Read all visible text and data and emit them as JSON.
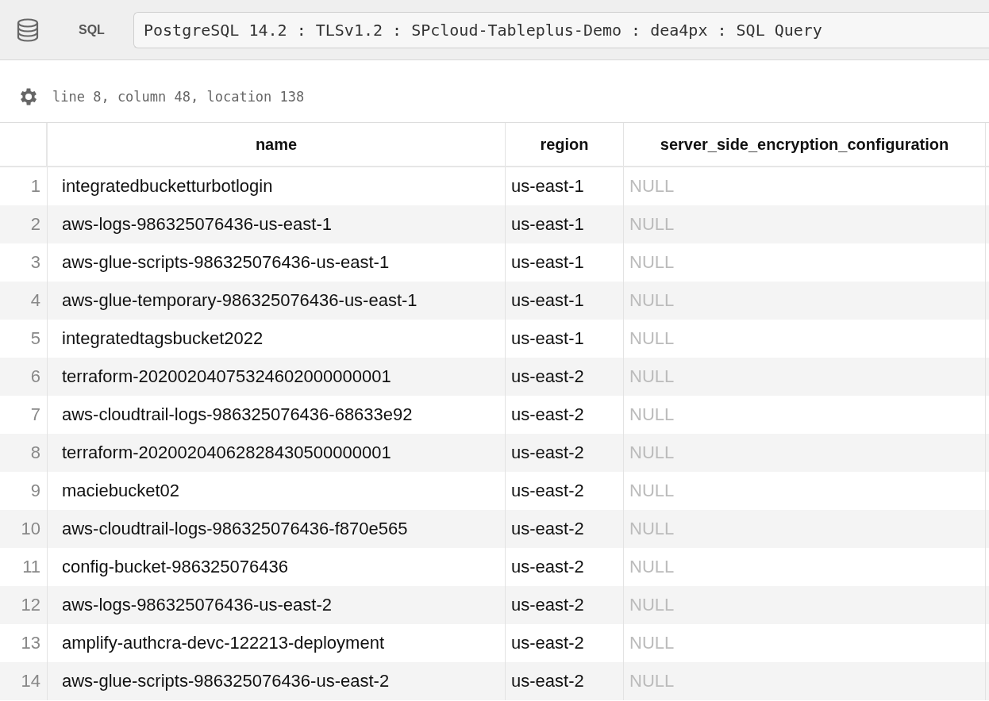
{
  "toolbar": {
    "label": "SQL",
    "connection": "PostgreSQL 14.2 : TLSv1.2 : SPcloud-Tableplus-Demo : dea4px : SQL Query"
  },
  "status": "line 8, column 48, location 138",
  "table": {
    "columns": [
      "name",
      "region",
      "server_side_encryption_configuration"
    ],
    "rows": [
      {
        "num": "1",
        "name": "integratedbucketturbotlogin",
        "region": "us-east-1",
        "config": "NULL"
      },
      {
        "num": "2",
        "name": "aws-logs-986325076436-us-east-1",
        "region": "us-east-1",
        "config": "NULL"
      },
      {
        "num": "3",
        "name": "aws-glue-scripts-986325076436-us-east-1",
        "region": "us-east-1",
        "config": "NULL"
      },
      {
        "num": "4",
        "name": "aws-glue-temporary-986325076436-us-east-1",
        "region": "us-east-1",
        "config": "NULL"
      },
      {
        "num": "5",
        "name": "integratedtagsbucket2022",
        "region": "us-east-1",
        "config": "NULL"
      },
      {
        "num": "6",
        "name": "terraform-20200204075324602000000001",
        "region": "us-east-2",
        "config": "NULL"
      },
      {
        "num": "7",
        "name": "aws-cloudtrail-logs-986325076436-68633e92",
        "region": "us-east-2",
        "config": "NULL"
      },
      {
        "num": "8",
        "name": "terraform-20200204062828430500000001",
        "region": "us-east-2",
        "config": "NULL"
      },
      {
        "num": "9",
        "name": "maciebucket02",
        "region": "us-east-2",
        "config": "NULL"
      },
      {
        "num": "10",
        "name": "aws-cloudtrail-logs-986325076436-f870e565",
        "region": "us-east-2",
        "config": "NULL"
      },
      {
        "num": "11",
        "name": "config-bucket-986325076436",
        "region": "us-east-2",
        "config": "NULL"
      },
      {
        "num": "12",
        "name": "aws-logs-986325076436-us-east-2",
        "region": "us-east-2",
        "config": "NULL"
      },
      {
        "num": "13",
        "name": "amplify-authcra-devc-122213-deployment",
        "region": "us-east-2",
        "config": "NULL"
      },
      {
        "num": "14",
        "name": "aws-glue-scripts-986325076436-us-east-2",
        "region": "us-east-2",
        "config": "NULL"
      }
    ]
  }
}
